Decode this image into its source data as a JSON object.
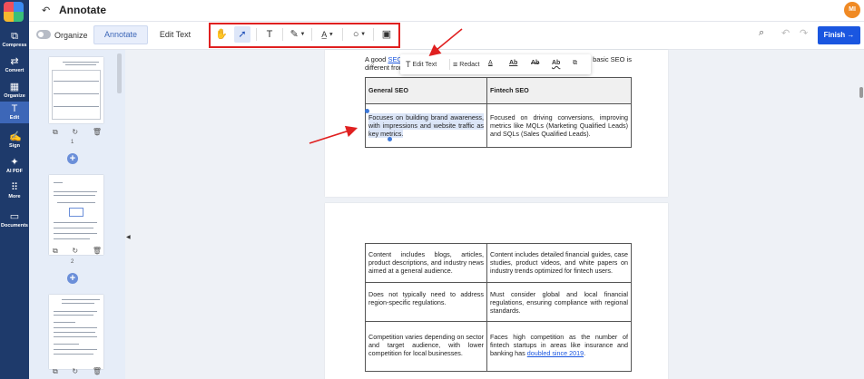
{
  "app": {
    "title": "Annotate",
    "user_initials": "MI"
  },
  "rail": {
    "items": [
      {
        "label": "Compress",
        "icon": "compress-icon"
      },
      {
        "label": "Convert",
        "icon": "convert-icon"
      },
      {
        "label": "Organize",
        "icon": "organize-icon"
      },
      {
        "label": "Edit",
        "icon": "edit-icon"
      },
      {
        "label": "Sign",
        "icon": "sign-icon"
      },
      {
        "label": "AI PDF",
        "icon": "ai-pdf-icon"
      },
      {
        "label": "More",
        "icon": "more-icon"
      },
      {
        "label": "Documents",
        "icon": "documents-icon"
      }
    ],
    "active": "Edit"
  },
  "toolbar": {
    "organize_label": "Organize",
    "modes": [
      "Annotate",
      "Edit Text"
    ],
    "active_mode": "Annotate",
    "finish_label": "Finish"
  },
  "thumbnails": {
    "page_numbers": [
      "1",
      "2"
    ]
  },
  "floating_bar": {
    "edit_text": "Edit Text",
    "redact": "Redact"
  },
  "document": {
    "intro_start": "A good ",
    "intro_link": "SEO",
    "intro_tail": "basic SEO is",
    "intro_line2": "different from",
    "table1": {
      "headers": [
        "General SEO",
        "Fintech SEO"
      ],
      "row": [
        "Focuses on building brand awareness, with impressions and website traffic as key metrics.",
        "Focused on driving conversions, improving metrics like MQLs (Marketing Qualified Leads) and SQLs (Sales Qualified Leads)."
      ]
    },
    "table2": {
      "rows": [
        [
          "Content includes blogs, articles, product descriptions, and industry news aimed at a general audience.",
          "Content includes detailed financial guides, case studies, product videos, and white papers on industry trends optimized for fintech users."
        ],
        [
          "Does not typically need to address region-specific regulations.",
          "Must consider global and local financial regulations, ensuring compliance with regional standards."
        ],
        [
          "Competition varies depending on sector and target audience, with lower competition for local businesses.",
          "Faces high competition as the number of fintech startups in areas like insurance and banking has"
        ]
      ],
      "last_link": "doubled since 2019",
      "last_link_suffix": "."
    }
  },
  "colors": {
    "accent": "#1a56e0",
    "rail": "#1e3a6b",
    "annotation": "#e02020",
    "avatar": "#f08a24"
  }
}
